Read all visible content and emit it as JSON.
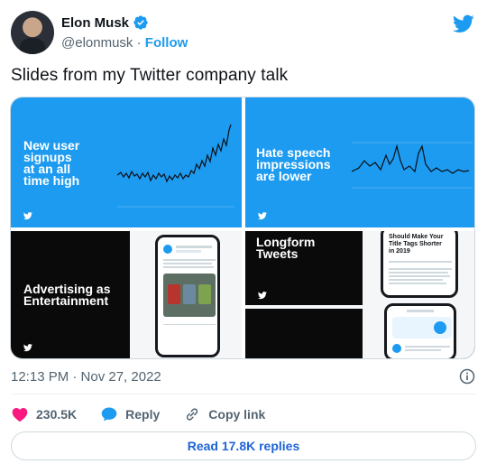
{
  "author": {
    "name": "Elon Musk",
    "handle": "@elonmusk",
    "separator": "·",
    "follow_label": "Follow"
  },
  "tweet": {
    "text": "Slides from my Twitter company talk",
    "timestamp": "12:13 PM · Nov 27, 2022"
  },
  "media": {
    "slides": [
      {
        "title_lines": [
          "New user",
          "signups",
          "at an all",
          "time high"
        ]
      },
      {
        "title_lines": [
          "Hate speech",
          "impressions",
          "are lower"
        ]
      },
      {
        "title_lines": [
          "Advertising as",
          "Entertainment"
        ]
      },
      {
        "title_lines": [
          "Longform",
          "Tweets"
        ],
        "phone_text": [
          "Should Make Your",
          "Title Tags Shorter",
          "in 2019"
        ]
      }
    ]
  },
  "actions": {
    "like_count": "230.5K",
    "reply_label": "Reply",
    "copy_link_label": "Copy link"
  },
  "read_replies_label": "Read 17.8K replies",
  "icons": {
    "verified": "verified-badge-icon",
    "brand": "twitter-bird-icon",
    "info": "info-icon",
    "like": "heart-icon",
    "reply": "speech-bubble-icon",
    "copy": "link-icon"
  },
  "colors": {
    "accent": "#1d9bf0",
    "like": "#f91880",
    "text": "#0f1419",
    "muted": "#536471"
  }
}
